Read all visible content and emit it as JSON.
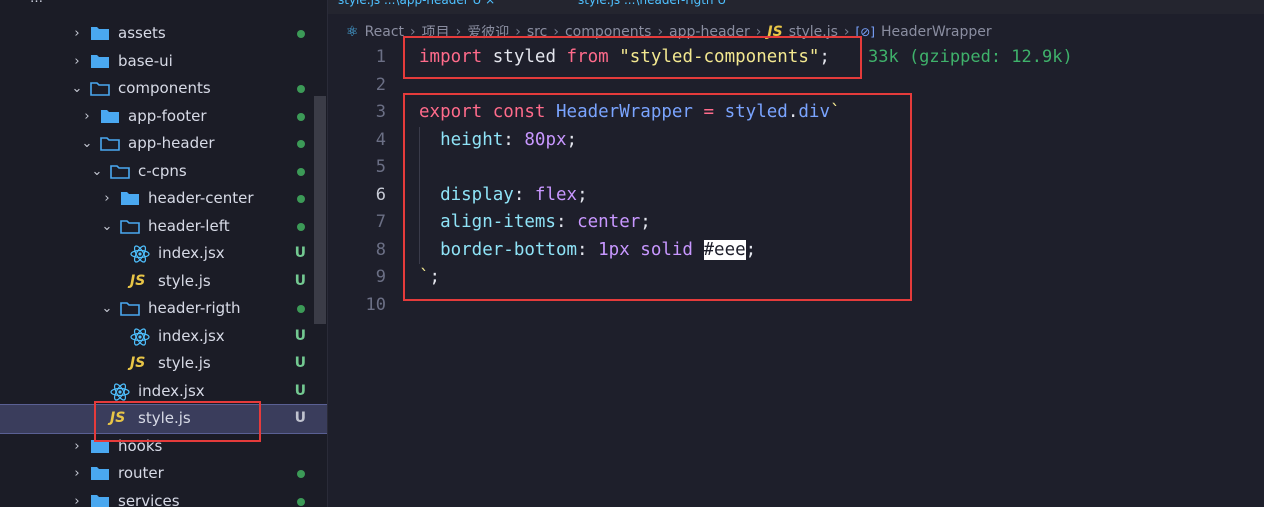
{
  "explorer": {
    "top_label": "…"
  },
  "tree": [
    {
      "label": "assets",
      "type": "folder",
      "depth": 0,
      "expanded": false,
      "status": "dot"
    },
    {
      "label": "base-ui",
      "type": "folder",
      "depth": 0,
      "expanded": false,
      "status": ""
    },
    {
      "label": "components",
      "type": "folder",
      "depth": 0,
      "expanded": true,
      "status": "dot"
    },
    {
      "label": "app-footer",
      "type": "folder",
      "depth": 1,
      "expanded": false,
      "status": "dot"
    },
    {
      "label": "app-header",
      "type": "folder",
      "depth": 1,
      "expanded": true,
      "status": "dot"
    },
    {
      "label": "c-cpns",
      "type": "folder",
      "depth": 2,
      "expanded": true,
      "status": "dot"
    },
    {
      "label": "header-center",
      "type": "folder",
      "depth": 3,
      "expanded": false,
      "status": "dot"
    },
    {
      "label": "header-left",
      "type": "folder",
      "depth": 3,
      "expanded": true,
      "status": "dot"
    },
    {
      "label": "index.jsx",
      "type": "react",
      "depth": 4,
      "status": "U"
    },
    {
      "label": "style.js",
      "type": "js",
      "depth": 4,
      "status": "U"
    },
    {
      "label": "header-rigth",
      "type": "folder",
      "depth": 3,
      "expanded": true,
      "status": "dot"
    },
    {
      "label": "index.jsx",
      "type": "react",
      "depth": 4,
      "status": "U"
    },
    {
      "label": "style.js",
      "type": "js",
      "depth": 4,
      "status": "U"
    },
    {
      "label": "index.jsx",
      "type": "react",
      "depth": 2,
      "status": "U"
    },
    {
      "label": "style.js",
      "type": "js",
      "depth": 2,
      "status": "U",
      "selected": true
    },
    {
      "label": "hooks",
      "type": "folder",
      "depth": 0,
      "expanded": false,
      "status": ""
    },
    {
      "label": "router",
      "type": "folder",
      "depth": 0,
      "expanded": false,
      "status": "dot"
    },
    {
      "label": "services",
      "type": "folder",
      "depth": 0,
      "expanded": false,
      "status": "dot"
    }
  ],
  "tabs": [
    {
      "label": "style.js  ...\\app-header  U  ×"
    },
    {
      "label": "style.js  ...\\header-rigth  U"
    }
  ],
  "breadcrumb": [
    "React",
    "项目",
    "爱彼迎",
    "src",
    "components",
    "app-header",
    "style.js",
    "HeaderWrapper"
  ],
  "breadcrumb_icons": {
    "file": "JS",
    "symbol": "[⊘]"
  },
  "editor": {
    "active_line": 6,
    "line_numbers": [
      "1",
      "2",
      "3",
      "4",
      "5",
      "6",
      "7",
      "8",
      "9",
      "10"
    ],
    "import_size_hint": "33k (gzipped: 12.9k)"
  },
  "colors": {
    "accent_red": "#e53b3b",
    "keyword": "#ff6b8b",
    "string": "#f3e890",
    "property": "#8fe3f7",
    "value": "#c897ff",
    "untracked": "#73c991",
    "git_dot": "#3c9a57"
  }
}
